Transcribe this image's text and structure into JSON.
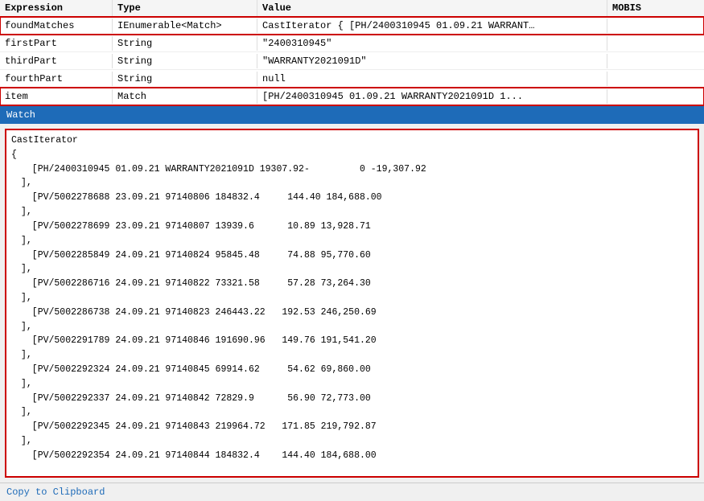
{
  "header": {
    "col1": "Expression",
    "col2": "Type",
    "col3": "Value",
    "col4": "MOBIS"
  },
  "rows": [
    {
      "expression": "foundMatches",
      "type": "IEnumerable<Match>",
      "value": "CastIterator { [PH/2400310945 01.09.21 WARRANT…",
      "highlighted": true
    },
    {
      "expression": "firstPart",
      "type": "String",
      "value": "\"2400310945\"",
      "highlighted": false
    },
    {
      "expression": "thirdPart",
      "type": "String",
      "value": "\"WARRANTY2021091D\"",
      "highlighted": false
    },
    {
      "expression": "fourthPart",
      "type": "String",
      "value": "null",
      "highlighted": false
    },
    {
      "expression": "item",
      "type": "Match",
      "value": "[PH/2400310945 01.09.21 WARRANTY2021091D 1...",
      "highlighted": true
    }
  ],
  "watch": {
    "label": "Watch",
    "content_title": "CastIterator",
    "entries": [
      "{",
      "  [PH/2400310945 01.09.21 WARRANTY2021091D 19307.92-         0 -19,307.92",
      "],",
      "  [PV/5002278688 23.09.21 97140806 184832.4     144.40 184,688.00",
      "],",
      "  [PV/5002278699 23.09.21 97140807 13939.6      10.89 13,928.71",
      "],",
      "  [PV/5002285849 24.09.21 97140824 95845.48     74.88 95,770.60",
      "],",
      "  [PV/5002286716 24.09.21 97140822 73321.58     57.28 73,264.30",
      "],",
      "  [PV/5002286738 24.09.21 97140823 246443.22   192.53 246,250.69",
      "],",
      "  [PV/5002291789 24.09.21 97140846 191690.96   149.76 191,541.20",
      "],",
      "  [PV/5002292324 24.09.21 97140845 69914.62     54.62 69,860.00",
      "],",
      "  [PV/5002292337 24.09.21 97140842 72829.9      56.90 72,773.00",
      "],",
      "  [PV/5002292345 24.09.21 97140843 219964.72   171.85 219,792.87",
      "],",
      "  [PV/5002292354 24.09.21 97140844 184832.4    144.40 184,688.00"
    ]
  },
  "bottom": {
    "copy_label": "Copy to Clipboard"
  }
}
